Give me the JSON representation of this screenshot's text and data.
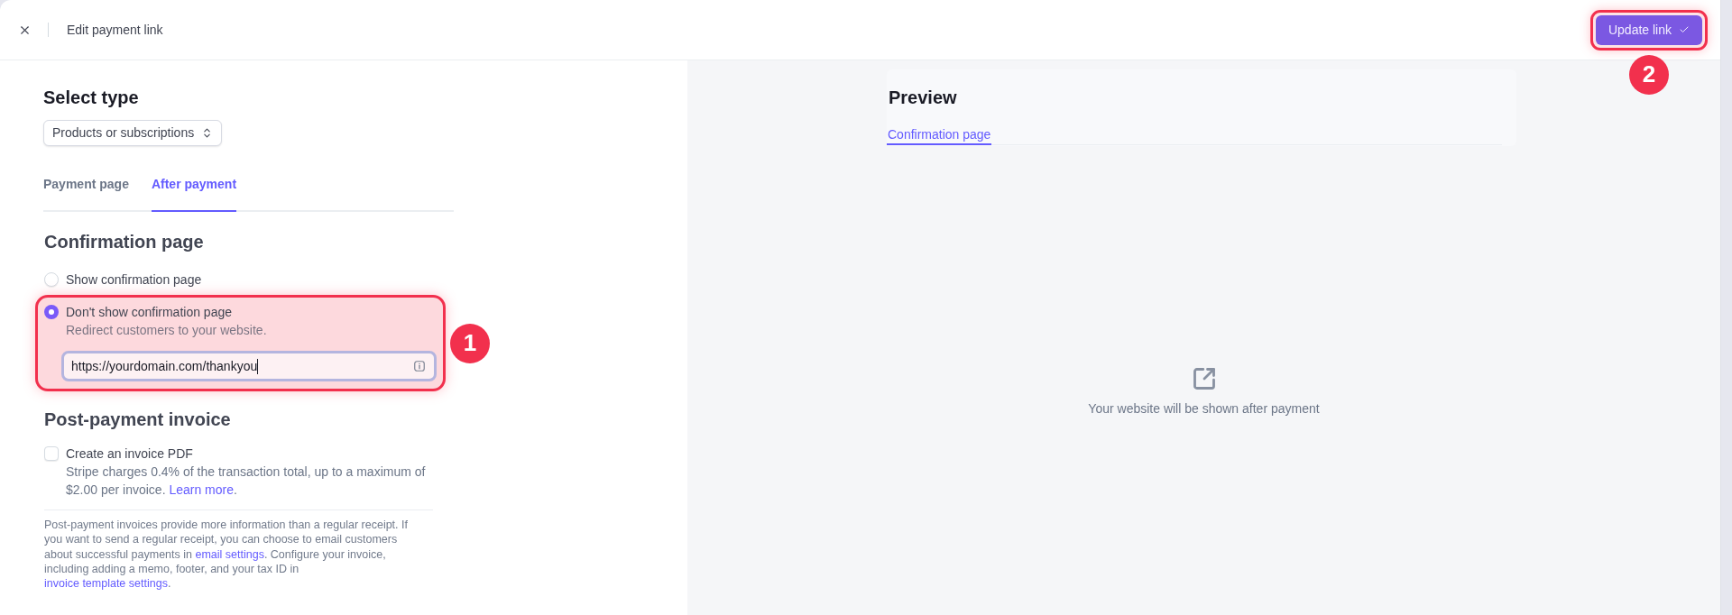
{
  "header": {
    "title": "Edit payment link",
    "primary_button": {
      "label": "Update link",
      "annotation": "2"
    }
  },
  "select_type": {
    "heading": "Select type",
    "value": "Products or subscriptions"
  },
  "tabs": [
    {
      "label": "Payment page",
      "selected": false
    },
    {
      "label": "After payment",
      "selected": true
    }
  ],
  "confirmation": {
    "heading": "Confirmation page",
    "options": [
      {
        "label": "Show confirmation page",
        "selected": false
      },
      {
        "label": "Don't show confirmation page",
        "description": "Redirect customers to your website.",
        "selected": true,
        "redirect_url": "https://yourdomain.com/thankyou",
        "annotation": "1"
      }
    ]
  },
  "invoice": {
    "heading": "Post-payment invoice",
    "checkbox": {
      "label": "Create an invoice PDF",
      "checked": false,
      "description": [
        {
          "kind": "text",
          "text": "Stripe charges 0.4% of the transaction total, up to a maximum of $2.00 per invoice. "
        },
        {
          "kind": "link",
          "text": "Learn more"
        },
        {
          "kind": "text",
          "text": "."
        }
      ]
    },
    "note": [
      {
        "kind": "text",
        "text": "Post-payment invoices provide more information than a regular receipt. If you want to send a regular receipt, you can choose to email customers about successful payments in "
      },
      {
        "kind": "link",
        "text": "email settings"
      },
      {
        "kind": "text",
        "text": ". Configure your invoice, including adding a memo, footer, and your tax ID in "
      },
      {
        "kind": "link",
        "text": "invoice template settings"
      },
      {
        "kind": "text",
        "text": "."
      }
    ]
  },
  "preview": {
    "heading": "Preview",
    "tabs": [
      {
        "label": "Confirmation page",
        "selected": true
      }
    ],
    "empty_message": "Your website will be shown after payment"
  }
}
